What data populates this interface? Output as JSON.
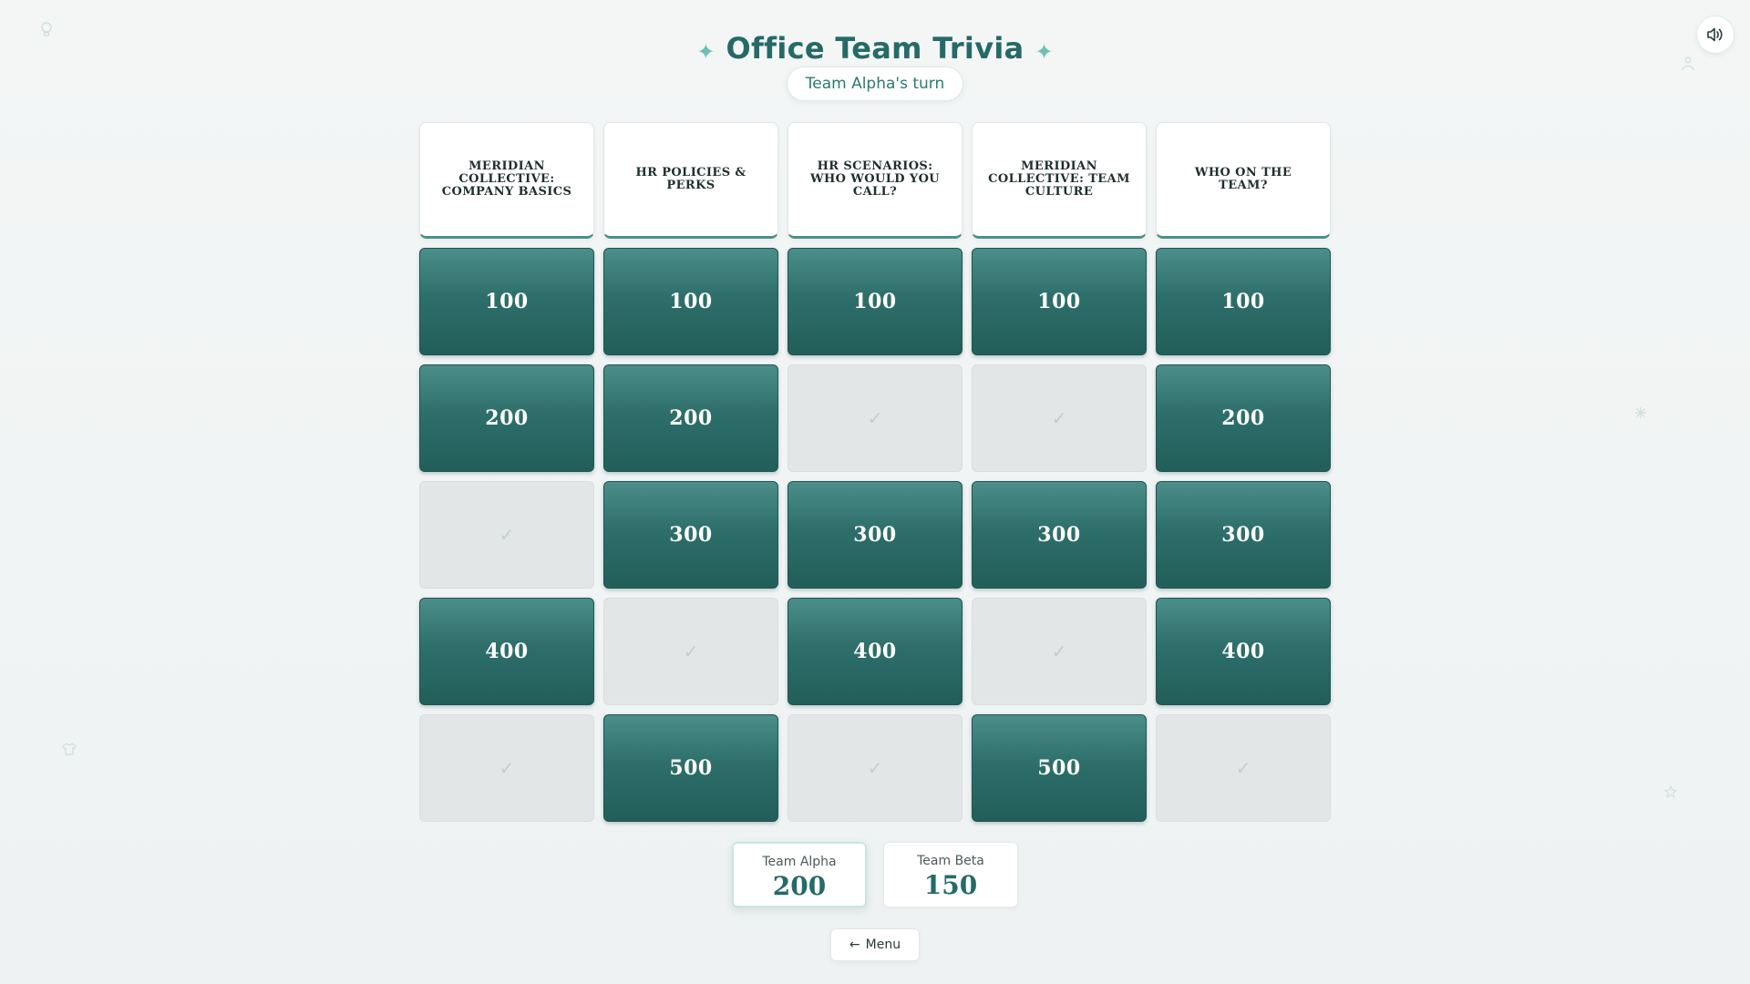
{
  "header": {
    "title": "Office Team Trivia",
    "sparkle_glyph": "✦",
    "turn": "Team Alpha's turn"
  },
  "sound": {
    "icon": "speaker-icon"
  },
  "categories": [
    "MERIDIAN COLLECTIVE: COMPANY BASICS",
    "HR POLICIES & PERKS",
    "HR SCENARIOS: WHO WOULD YOU CALL?",
    "MERIDIAN COLLECTIVE: TEAM CULTURE",
    "WHO ON THE TEAM?"
  ],
  "used_glyph": "✓",
  "board": [
    [
      {
        "value": "100",
        "used": false
      },
      {
        "value": "100",
        "used": false
      },
      {
        "value": "100",
        "used": false
      },
      {
        "value": "100",
        "used": false
      },
      {
        "value": "100",
        "used": false
      }
    ],
    [
      {
        "value": "200",
        "used": false
      },
      {
        "value": "200",
        "used": false
      },
      {
        "value": "200",
        "used": true
      },
      {
        "value": "200",
        "used": true
      },
      {
        "value": "200",
        "used": false
      }
    ],
    [
      {
        "value": "300",
        "used": true
      },
      {
        "value": "300",
        "used": false
      },
      {
        "value": "300",
        "used": false
      },
      {
        "value": "300",
        "used": false
      },
      {
        "value": "300",
        "used": false
      }
    ],
    [
      {
        "value": "400",
        "used": false
      },
      {
        "value": "400",
        "used": true
      },
      {
        "value": "400",
        "used": false
      },
      {
        "value": "400",
        "used": true
      },
      {
        "value": "400",
        "used": false
      }
    ],
    [
      {
        "value": "500",
        "used": true
      },
      {
        "value": "500",
        "used": false
      },
      {
        "value": "500",
        "used": true
      },
      {
        "value": "500",
        "used": false
      },
      {
        "value": "500",
        "used": true
      }
    ]
  ],
  "teams": [
    {
      "name": "Team Alpha",
      "score": "200",
      "active": true
    },
    {
      "name": "Team Beta",
      "score": "150",
      "active": false
    }
  ],
  "menu": {
    "label": "Menu",
    "arrow": "←"
  },
  "colors": {
    "accent": "#256a67",
    "tile_top": "#4b8e8a",
    "tile_bottom": "#225e5a",
    "used_tile": "#e2e6e6",
    "background": "#f1f4f4"
  }
}
